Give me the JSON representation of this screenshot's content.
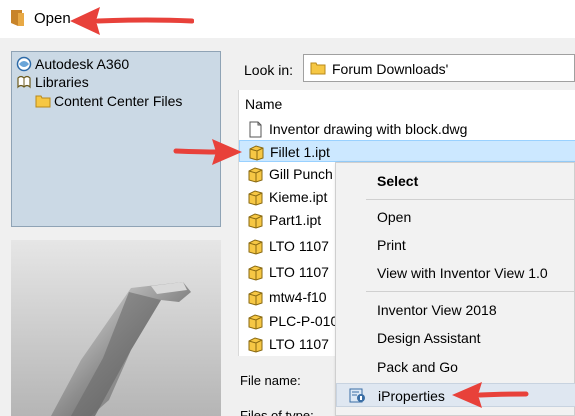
{
  "window": {
    "title": "Open"
  },
  "locations": {
    "items": [
      {
        "label": "Autodesk A360",
        "icon": "a360-icon"
      },
      {
        "label": "Libraries",
        "icon": "libraries-icon"
      },
      {
        "label": "Content Center Files",
        "icon": "folder-icon"
      }
    ]
  },
  "look_in": {
    "label": "Look in:",
    "value": "Forum Downloads'"
  },
  "file_list": {
    "column_name": "Name",
    "files": [
      {
        "name": "Inventor drawing with block.dwg",
        "icon": "document-icon"
      },
      {
        "name": "Fillet 1.ipt",
        "icon": "part-icon"
      },
      {
        "name": "Gill Punch",
        "icon": "part-icon"
      },
      {
        "name": "Kieme.ipt",
        "icon": "part-icon"
      },
      {
        "name": "Part1.ipt",
        "icon": "part-icon"
      },
      {
        "name": "LTO 1107",
        "icon": "part-icon"
      },
      {
        "name": "LTO 1107",
        "icon": "part-icon"
      },
      {
        "name": "mtw4-f10",
        "icon": "part-icon"
      },
      {
        "name": "PLC-P-010",
        "icon": "part-icon"
      },
      {
        "name": "LTO 1107",
        "icon": "part-icon"
      }
    ]
  },
  "fields": {
    "file_name_label": "File name:",
    "files_of_type_label": "Files of type:"
  },
  "context_menu": {
    "items": [
      {
        "label": "Select"
      },
      {
        "label": "Open"
      },
      {
        "label": "Print"
      },
      {
        "label": "View with Inventor View 1.0"
      },
      {
        "label": "Inventor View 2018"
      },
      {
        "label": "Design Assistant"
      },
      {
        "label": "Pack and Go"
      },
      {
        "label": "iProperties",
        "icon": "iproperties-icon"
      }
    ]
  },
  "colors": {
    "annotation_arrow": "#e8413a",
    "selection": "#cce8ff",
    "menu_hover": "#dfe7f1",
    "locations_pane": "#cbd9e5"
  }
}
